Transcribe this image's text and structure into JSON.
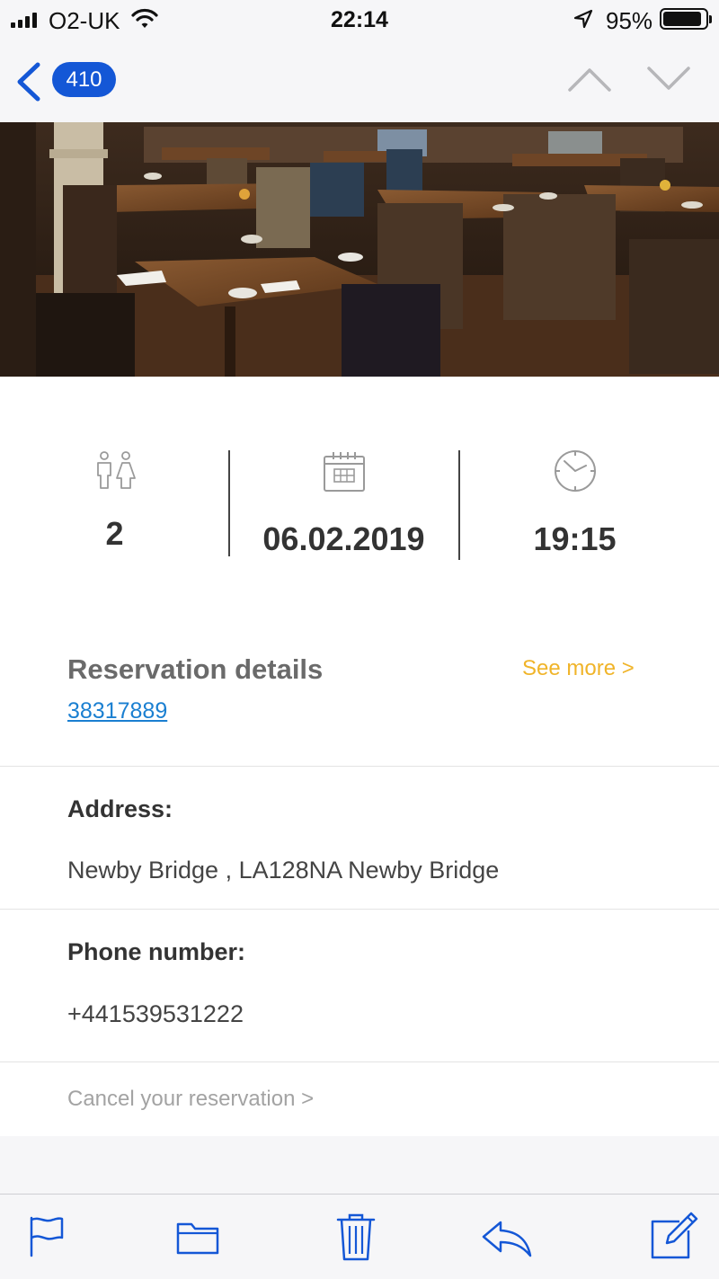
{
  "status_bar": {
    "carrier": "O2-UK",
    "time": "22:14",
    "battery_percent": "95%",
    "battery_level": 0.95
  },
  "nav": {
    "back_count": "410"
  },
  "hero": {
    "icon": "restaurant-photo"
  },
  "reservation": {
    "guests": "2",
    "date": "06.02.2019",
    "time": "19:15",
    "details_title": "Reservation details",
    "see_more": "See more >",
    "number": "38317889",
    "address_label": "Address:",
    "address": "Newby Bridge , LA128NA Newby Bridge",
    "phone_label": "Phone number:",
    "phone": "+441539531222",
    "cancel": "Cancel your reservation >"
  },
  "toolbar": {
    "icons": [
      "flag-icon",
      "folder-icon",
      "trash-icon",
      "reply-icon",
      "compose-icon"
    ]
  },
  "colors": {
    "accent_blue": "#1457d6",
    "link_blue": "#1a7fd1",
    "see_more_orange": "#f0b429"
  }
}
